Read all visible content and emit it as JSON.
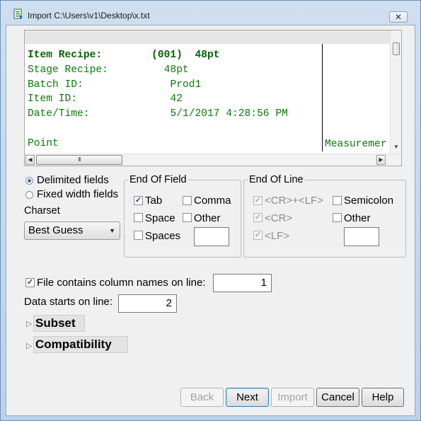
{
  "window": {
    "title": "Import C:\\Users\\v1\\Desktop\\x.txt",
    "close_glyph": "✕",
    "icon": "import-file-icon"
  },
  "preview": {
    "lines": [
      {
        "label": "Item Recipe:",
        "value": "(001)  48pt",
        "bold": true
      },
      {
        "label": "Stage Recipe:",
        "value": "48pt",
        "bold": false
      },
      {
        "label": "Batch ID:",
        "value": "Prod1",
        "bold": false
      },
      {
        "label": "Item ID:",
        "value": "42",
        "bold": false
      },
      {
        "label": "Date/Time:",
        "value": "5/1/2017 4:28:56 PM",
        "bold": false
      }
    ],
    "point_label": "Point",
    "measurement_label": "Measuremer",
    "hscroll_thumb_grip": "III"
  },
  "field_type": {
    "delimited": "Delimited fields",
    "fixed": "Fixed width fields",
    "selected": "delimited"
  },
  "charset": {
    "label": "Charset",
    "value": "Best Guess",
    "arrow": "▼"
  },
  "end_of_field": {
    "title": "End Of Field",
    "tab": "Tab",
    "tab_checked": true,
    "comma": "Comma",
    "comma_checked": false,
    "space": "Space",
    "space_checked": false,
    "other": "Other",
    "other_checked": false,
    "spaces": "Spaces",
    "spaces_checked": false,
    "other_value": ""
  },
  "end_of_line": {
    "title": "End Of Line",
    "crlf": "<CR>+<LF>",
    "crlf_checked": true,
    "cr": "<CR>",
    "cr_checked": true,
    "lf": "<LF>",
    "lf_checked": true,
    "semicolon": "Semicolon",
    "semicolon_checked": false,
    "other": "Other",
    "other_checked": false,
    "other_value": ""
  },
  "header_line": {
    "label": "File contains column names on line:",
    "checked": true,
    "value": "1"
  },
  "data_start": {
    "label": "Data starts on line:",
    "value": "2"
  },
  "sections": {
    "subset": "Subset",
    "compatibility": "Compatibility",
    "triangle": "▷"
  },
  "buttons": {
    "back": "Back",
    "next": "Next",
    "import": "Import",
    "cancel": "Cancel",
    "help": "Help"
  }
}
